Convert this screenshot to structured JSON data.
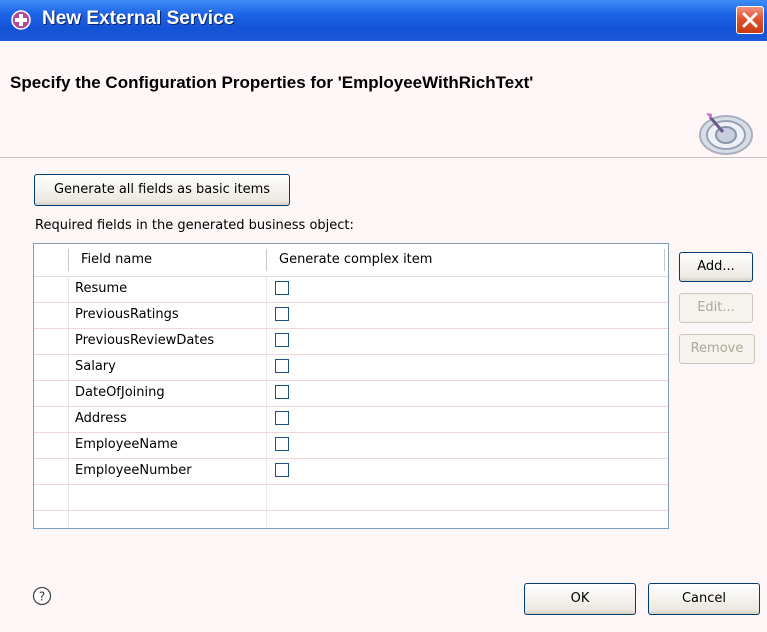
{
  "window": {
    "title": "New External Service",
    "close_icon": "close-icon"
  },
  "header": {
    "heading": "Specify the Configuration Properties for 'EmployeeWithRichText'",
    "graphic_icon": "wizard-banner-icon"
  },
  "form": {
    "generate_all_label": "Generate all fields as basic items",
    "required_fields_label": "Required fields in the generated business object:",
    "table": {
      "columns": [
        "Field name",
        "Generate complex item"
      ],
      "rows": [
        {
          "field": "Resume",
          "complex": false
        },
        {
          "field": "PreviousRatings",
          "complex": false
        },
        {
          "field": "PreviousReviewDates",
          "complex": false
        },
        {
          "field": "Salary",
          "complex": false
        },
        {
          "field": "DateOfJoining",
          "complex": false
        },
        {
          "field": "Address",
          "complex": false
        },
        {
          "field": "EmployeeName",
          "complex": false
        },
        {
          "field": "EmployeeNumber",
          "complex": false
        }
      ]
    },
    "side_buttons": {
      "add": "Add...",
      "edit": "Edit...",
      "remove": "Remove"
    }
  },
  "footer": {
    "help_icon": "help-icon",
    "ok": "OK",
    "cancel": "Cancel"
  }
}
